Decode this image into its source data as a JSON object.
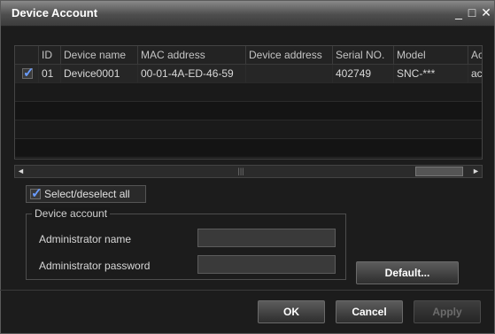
{
  "window": {
    "title": "Device Account",
    "minimize_glyph": "_",
    "maximize_glyph": "□",
    "close_glyph": "✕"
  },
  "table": {
    "columns": [
      "",
      "ID",
      "Device name",
      "MAC address",
      "Device address",
      "Serial NO.",
      "Model",
      "Ac"
    ],
    "rows": [
      {
        "checked": true,
        "id": "01",
        "device_name": "Device0001",
        "mac_address": "00-01-4A-ED-46-59",
        "device_address": "",
        "serial_no": "402749",
        "model": "SNC-***",
        "account": "ac"
      }
    ]
  },
  "scrollbar": {
    "left_arrow": "◄",
    "right_arrow": "►",
    "grip": "|||"
  },
  "select_all": {
    "label": "Select/deselect all",
    "checked": true
  },
  "device_account": {
    "legend": "Device account",
    "admin_name_label": "Administrator name",
    "admin_name_value": "",
    "admin_password_label": "Administrator password",
    "admin_password_value": ""
  },
  "buttons": {
    "default": "Default...",
    "ok": "OK",
    "cancel": "Cancel",
    "apply": "Apply"
  },
  "colors": {
    "background": "#1a1a1a",
    "check_accent": "#6a9cff",
    "title_gradient_top": "#8a8a8a"
  },
  "icons": {
    "check": "check-icon",
    "close": "close-icon",
    "minimize": "minimize-icon",
    "maximize": "maximize-icon"
  }
}
